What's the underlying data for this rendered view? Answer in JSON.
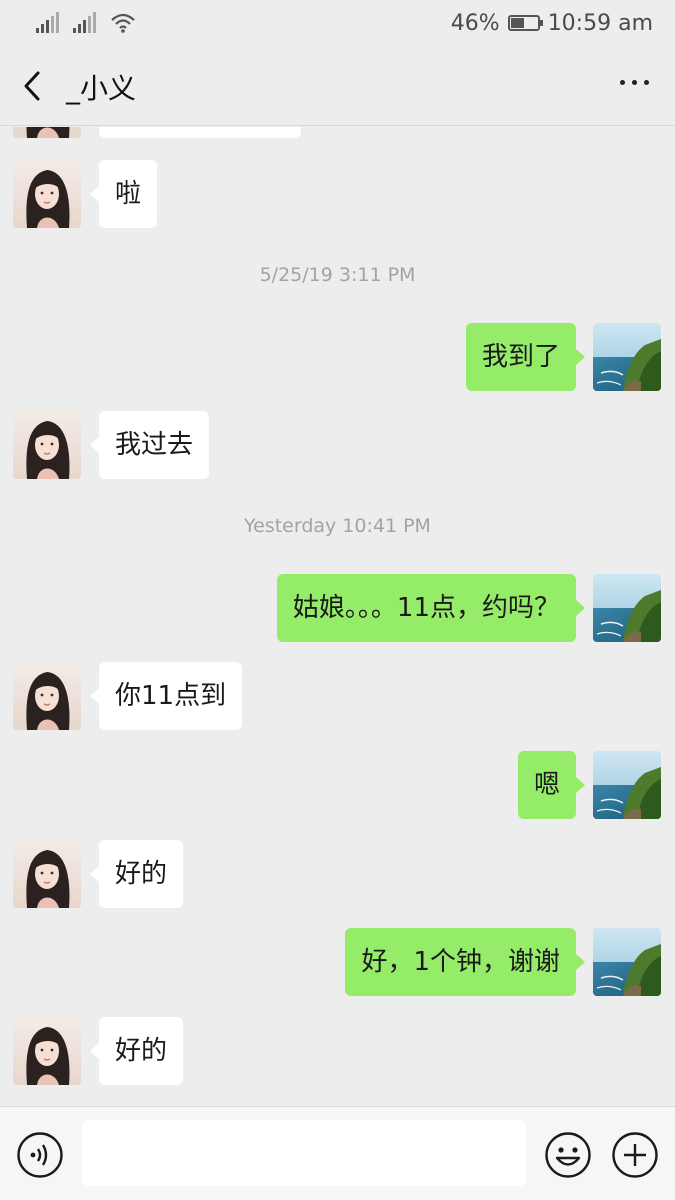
{
  "status_bar": {
    "battery": "46%",
    "time": "10:59 am"
  },
  "header": {
    "title": "_小义"
  },
  "messages": [
    {
      "side": "in",
      "text": ""
    },
    {
      "side": "in",
      "text": "啦"
    },
    {
      "type": "time",
      "text": "5/25/19 3:11 PM"
    },
    {
      "side": "out",
      "text": "我到了"
    },
    {
      "side": "in",
      "text": "我过去"
    },
    {
      "type": "time",
      "text": "Yesterday 10:41 PM"
    },
    {
      "side": "out",
      "text": "姑娘。。。11点，约吗？"
    },
    {
      "side": "in",
      "text": "你11点到"
    },
    {
      "side": "out",
      "text": "嗯"
    },
    {
      "side": "in",
      "text": "好的"
    },
    {
      "side": "out",
      "text": "好，1个钟，谢谢"
    },
    {
      "side": "in",
      "text": "好的"
    }
  ],
  "input_bar": {
    "message_value": ""
  },
  "colors": {
    "outgoing_bubble": "#95ec69",
    "incoming_bubble": "#ffffff",
    "background": "#ededed"
  }
}
